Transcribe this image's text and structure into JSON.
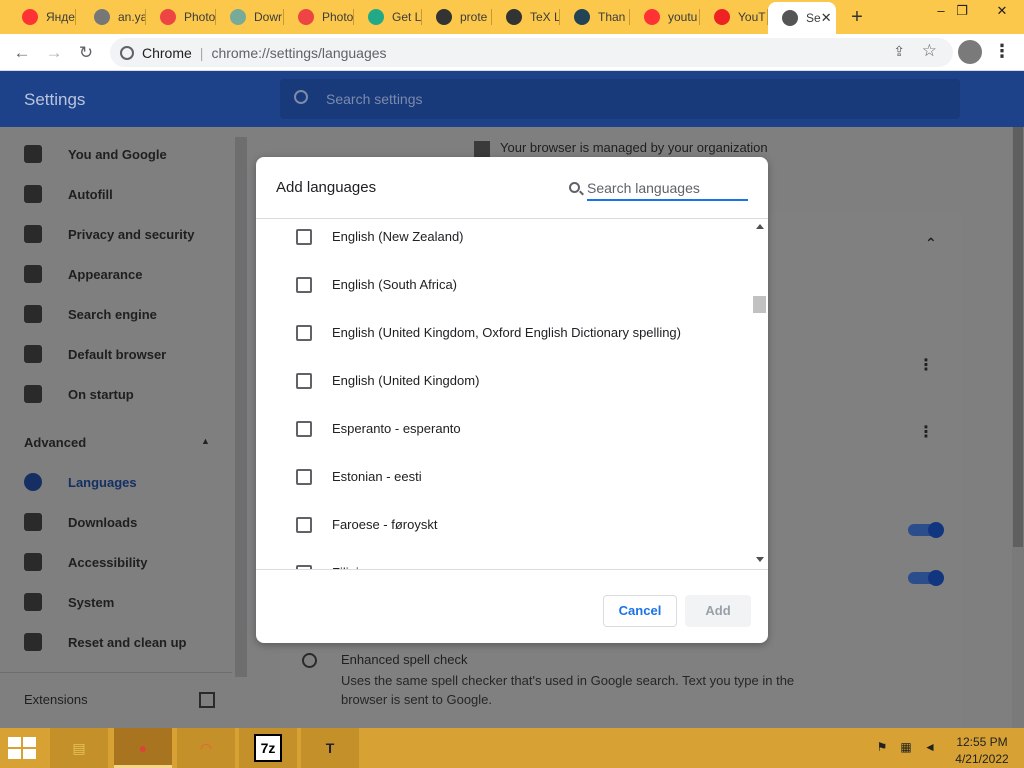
{
  "browser": {
    "tabs": [
      {
        "label": "Янде",
        "icon": "yandex-icon",
        "color": "#f33"
      },
      {
        "label": "an.ya",
        "icon": "globe-icon",
        "color": "#777"
      },
      {
        "label": "Photo",
        "icon": "photopea-icon",
        "color": "#e44"
      },
      {
        "label": "Dowr",
        "icon": "globe-icon",
        "color": "#7a9"
      },
      {
        "label": "Photo",
        "icon": "photopea-icon",
        "color": "#e44"
      },
      {
        "label": "Get L",
        "icon": "bird-icon",
        "color": "#2a8"
      },
      {
        "label": "prote",
        "icon": "tex-icon",
        "color": "#333"
      },
      {
        "label": "TeX L",
        "icon": "tex-icon",
        "color": "#333"
      },
      {
        "label": "Than",
        "icon": "tex-circle-icon",
        "color": "#245"
      },
      {
        "label": "youtu",
        "icon": "yandex-icon",
        "color": "#f33"
      },
      {
        "label": "YouT",
        "icon": "youtube-icon",
        "color": "#e22"
      },
      {
        "label": "Se",
        "icon": "gear-icon",
        "color": "#555",
        "active": true
      }
    ],
    "new_tab_glyph": "+",
    "close_glyph": "✕",
    "window_controls": {
      "minimize": "–",
      "restore": "❐",
      "close": "✕"
    },
    "omnibox": {
      "site_label": "Chrome",
      "divider": "|",
      "url": "chrome://settings/languages"
    }
  },
  "settings": {
    "title": "Settings",
    "search_placeholder": "Search settings",
    "managed_prefix": "Your browser is managed",
    "managed_suffix": "by your organization",
    "nav": [
      {
        "label": "You and Google",
        "icon": "person-icon"
      },
      {
        "label": "Autofill",
        "icon": "clipboard-icon"
      },
      {
        "label": "Privacy and security",
        "icon": "shield-icon"
      },
      {
        "label": "Appearance",
        "icon": "palette-icon"
      },
      {
        "label": "Search engine",
        "icon": "search-icon"
      },
      {
        "label": "Default browser",
        "icon": "browser-window-icon"
      },
      {
        "label": "On startup",
        "icon": "power-icon"
      }
    ],
    "advanced_label": "Advanced",
    "advanced_chevron": "▲",
    "advanced_nav": [
      {
        "label": "Languages",
        "icon": "globe-icon",
        "active": true
      },
      {
        "label": "Downloads",
        "icon": "download-icon"
      },
      {
        "label": "Accessibility",
        "icon": "accessibility-icon"
      },
      {
        "label": "System",
        "icon": "wrench-icon"
      },
      {
        "label": "Reset and clean up",
        "icon": "history-icon"
      }
    ],
    "extensions_label": "Extensions",
    "card": {
      "collapse_glyph": "⌃",
      "kebab_glyph": "⋮"
    },
    "enhanced_spell": {
      "title": "Enhanced spell check",
      "description": "Uses the same spell checker that's used in Google search. Text you type in the browser is sent to Google."
    }
  },
  "dialog": {
    "title": "Add languages",
    "search_placeholder": "Search languages",
    "languages": [
      "English (New Zealand)",
      "English (South Africa)",
      "English (United Kingdom, Oxford English Dictionary spelling)",
      "English (United Kingdom)",
      "Esperanto - esperanto",
      "Estonian - eesti",
      "Faroese - føroyskt",
      "Filipino"
    ],
    "cancel_label": "Cancel",
    "add_label": "Add"
  },
  "taskbar": {
    "apps": [
      {
        "name": "file-explorer-icon",
        "glyph": "▤",
        "color": "#e8c25a"
      },
      {
        "name": "chrome-icon",
        "glyph": "●",
        "color": "#db4437",
        "active": true
      },
      {
        "name": "photopea-icon",
        "glyph": "◠",
        "color": "#ef5a3a"
      },
      {
        "name": "7zip-icon",
        "glyph": "7z",
        "color": "#000"
      },
      {
        "name": "texstudio-icon",
        "glyph": "T",
        "color": "#223"
      }
    ],
    "tray": [
      {
        "name": "flag-alert-icon",
        "glyph": "⚑"
      },
      {
        "name": "network-alert-icon",
        "glyph": "▦"
      },
      {
        "name": "volume-muted-icon",
        "glyph": "◄"
      }
    ],
    "time": "12:55 PM",
    "date": "4/21/2022"
  }
}
